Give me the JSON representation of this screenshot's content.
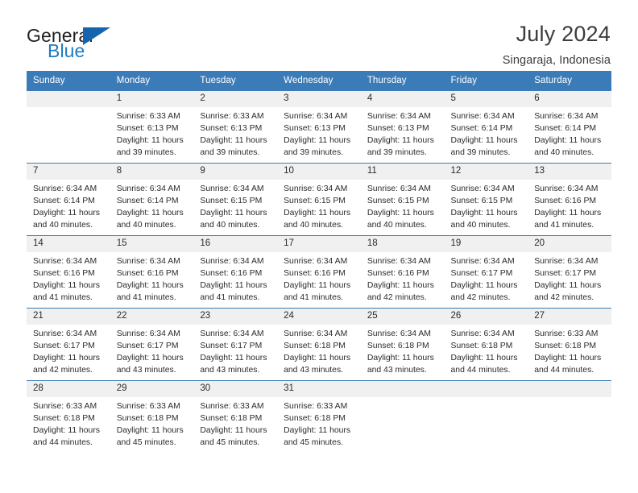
{
  "brand": {
    "name_part1": "General",
    "name_part2": "Blue",
    "triangle_icon": "triangle-icon"
  },
  "header": {
    "title": "July 2024",
    "location": "Singaraja, Indonesia"
  },
  "colors": {
    "header_blue": "#3b7cb8",
    "brand_blue": "#1f7bc1",
    "daynum_band": "#f0f0f0",
    "text": "#2b2b2b"
  },
  "weekday_headers": [
    "Sunday",
    "Monday",
    "Tuesday",
    "Wednesday",
    "Thursday",
    "Friday",
    "Saturday"
  ],
  "labels": {
    "sunrise_prefix": "Sunrise:",
    "sunset_prefix": "Sunset:",
    "daylight_prefix": "Daylight:"
  },
  "weeks": [
    [
      {
        "empty": true
      },
      {
        "day": "1",
        "sunrise": "Sunrise: 6:33 AM",
        "sunset": "Sunset: 6:13 PM",
        "daylight1": "Daylight: 11 hours",
        "daylight2": "and 39 minutes."
      },
      {
        "day": "2",
        "sunrise": "Sunrise: 6:33 AM",
        "sunset": "Sunset: 6:13 PM",
        "daylight1": "Daylight: 11 hours",
        "daylight2": "and 39 minutes."
      },
      {
        "day": "3",
        "sunrise": "Sunrise: 6:34 AM",
        "sunset": "Sunset: 6:13 PM",
        "daylight1": "Daylight: 11 hours",
        "daylight2": "and 39 minutes."
      },
      {
        "day": "4",
        "sunrise": "Sunrise: 6:34 AM",
        "sunset": "Sunset: 6:13 PM",
        "daylight1": "Daylight: 11 hours",
        "daylight2": "and 39 minutes."
      },
      {
        "day": "5",
        "sunrise": "Sunrise: 6:34 AM",
        "sunset": "Sunset: 6:14 PM",
        "daylight1": "Daylight: 11 hours",
        "daylight2": "and 39 minutes."
      },
      {
        "day": "6",
        "sunrise": "Sunrise: 6:34 AM",
        "sunset": "Sunset: 6:14 PM",
        "daylight1": "Daylight: 11 hours",
        "daylight2": "and 40 minutes."
      }
    ],
    [
      {
        "day": "7",
        "sunrise": "Sunrise: 6:34 AM",
        "sunset": "Sunset: 6:14 PM",
        "daylight1": "Daylight: 11 hours",
        "daylight2": "and 40 minutes."
      },
      {
        "day": "8",
        "sunrise": "Sunrise: 6:34 AM",
        "sunset": "Sunset: 6:14 PM",
        "daylight1": "Daylight: 11 hours",
        "daylight2": "and 40 minutes."
      },
      {
        "day": "9",
        "sunrise": "Sunrise: 6:34 AM",
        "sunset": "Sunset: 6:15 PM",
        "daylight1": "Daylight: 11 hours",
        "daylight2": "and 40 minutes."
      },
      {
        "day": "10",
        "sunrise": "Sunrise: 6:34 AM",
        "sunset": "Sunset: 6:15 PM",
        "daylight1": "Daylight: 11 hours",
        "daylight2": "and 40 minutes."
      },
      {
        "day": "11",
        "sunrise": "Sunrise: 6:34 AM",
        "sunset": "Sunset: 6:15 PM",
        "daylight1": "Daylight: 11 hours",
        "daylight2": "and 40 minutes."
      },
      {
        "day": "12",
        "sunrise": "Sunrise: 6:34 AM",
        "sunset": "Sunset: 6:15 PM",
        "daylight1": "Daylight: 11 hours",
        "daylight2": "and 40 minutes."
      },
      {
        "day": "13",
        "sunrise": "Sunrise: 6:34 AM",
        "sunset": "Sunset: 6:16 PM",
        "daylight1": "Daylight: 11 hours",
        "daylight2": "and 41 minutes."
      }
    ],
    [
      {
        "day": "14",
        "sunrise": "Sunrise: 6:34 AM",
        "sunset": "Sunset: 6:16 PM",
        "daylight1": "Daylight: 11 hours",
        "daylight2": "and 41 minutes."
      },
      {
        "day": "15",
        "sunrise": "Sunrise: 6:34 AM",
        "sunset": "Sunset: 6:16 PM",
        "daylight1": "Daylight: 11 hours",
        "daylight2": "and 41 minutes."
      },
      {
        "day": "16",
        "sunrise": "Sunrise: 6:34 AM",
        "sunset": "Sunset: 6:16 PM",
        "daylight1": "Daylight: 11 hours",
        "daylight2": "and 41 minutes."
      },
      {
        "day": "17",
        "sunrise": "Sunrise: 6:34 AM",
        "sunset": "Sunset: 6:16 PM",
        "daylight1": "Daylight: 11 hours",
        "daylight2": "and 41 minutes."
      },
      {
        "day": "18",
        "sunrise": "Sunrise: 6:34 AM",
        "sunset": "Sunset: 6:16 PM",
        "daylight1": "Daylight: 11 hours",
        "daylight2": "and 42 minutes."
      },
      {
        "day": "19",
        "sunrise": "Sunrise: 6:34 AM",
        "sunset": "Sunset: 6:17 PM",
        "daylight1": "Daylight: 11 hours",
        "daylight2": "and 42 minutes."
      },
      {
        "day": "20",
        "sunrise": "Sunrise: 6:34 AM",
        "sunset": "Sunset: 6:17 PM",
        "daylight1": "Daylight: 11 hours",
        "daylight2": "and 42 minutes."
      }
    ],
    [
      {
        "day": "21",
        "sunrise": "Sunrise: 6:34 AM",
        "sunset": "Sunset: 6:17 PM",
        "daylight1": "Daylight: 11 hours",
        "daylight2": "and 42 minutes."
      },
      {
        "day": "22",
        "sunrise": "Sunrise: 6:34 AM",
        "sunset": "Sunset: 6:17 PM",
        "daylight1": "Daylight: 11 hours",
        "daylight2": "and 43 minutes."
      },
      {
        "day": "23",
        "sunrise": "Sunrise: 6:34 AM",
        "sunset": "Sunset: 6:17 PM",
        "daylight1": "Daylight: 11 hours",
        "daylight2": "and 43 minutes."
      },
      {
        "day": "24",
        "sunrise": "Sunrise: 6:34 AM",
        "sunset": "Sunset: 6:18 PM",
        "daylight1": "Daylight: 11 hours",
        "daylight2": "and 43 minutes."
      },
      {
        "day": "25",
        "sunrise": "Sunrise: 6:34 AM",
        "sunset": "Sunset: 6:18 PM",
        "daylight1": "Daylight: 11 hours",
        "daylight2": "and 43 minutes."
      },
      {
        "day": "26",
        "sunrise": "Sunrise: 6:34 AM",
        "sunset": "Sunset: 6:18 PM",
        "daylight1": "Daylight: 11 hours",
        "daylight2": "and 44 minutes."
      },
      {
        "day": "27",
        "sunrise": "Sunrise: 6:33 AM",
        "sunset": "Sunset: 6:18 PM",
        "daylight1": "Daylight: 11 hours",
        "daylight2": "and 44 minutes."
      }
    ],
    [
      {
        "day": "28",
        "sunrise": "Sunrise: 6:33 AM",
        "sunset": "Sunset: 6:18 PM",
        "daylight1": "Daylight: 11 hours",
        "daylight2": "and 44 minutes."
      },
      {
        "day": "29",
        "sunrise": "Sunrise: 6:33 AM",
        "sunset": "Sunset: 6:18 PM",
        "daylight1": "Daylight: 11 hours",
        "daylight2": "and 45 minutes."
      },
      {
        "day": "30",
        "sunrise": "Sunrise: 6:33 AM",
        "sunset": "Sunset: 6:18 PM",
        "daylight1": "Daylight: 11 hours",
        "daylight2": "and 45 minutes."
      },
      {
        "day": "31",
        "sunrise": "Sunrise: 6:33 AM",
        "sunset": "Sunset: 6:18 PM",
        "daylight1": "Daylight: 11 hours",
        "daylight2": "and 45 minutes."
      },
      {
        "empty": true
      },
      {
        "empty": true
      },
      {
        "empty": true
      }
    ]
  ]
}
